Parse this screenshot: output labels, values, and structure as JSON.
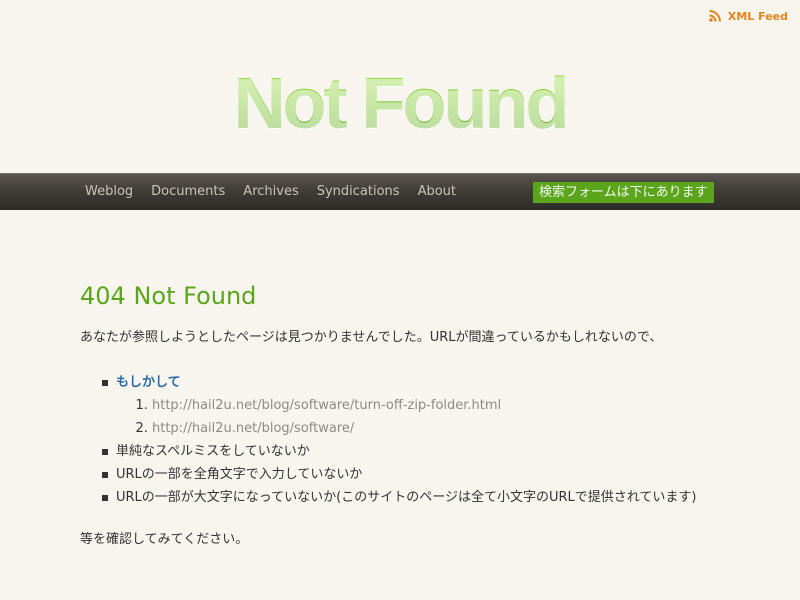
{
  "feed": {
    "label": "XML Feed",
    "icon": "rss-icon"
  },
  "logo": {
    "text": "Not Found"
  },
  "nav": {
    "items": [
      {
        "label": "Weblog"
      },
      {
        "label": "Documents"
      },
      {
        "label": "Archives"
      },
      {
        "label": "Syndications"
      },
      {
        "label": "About"
      }
    ],
    "search_note": "検索フォームは下にあります"
  },
  "main": {
    "heading": "404 Not Found",
    "intro": "あなたが参照しようとしたページは見つかりませんでした。URLが間違っているかもしれないので、",
    "checklist": [
      {
        "label": "もしかして"
      },
      {
        "label": "単純なスペルミスをしていないか"
      },
      {
        "label": "URLの一部を全角文字で入力していないか"
      },
      {
        "label": "URLの一部が大文字になっていないか(このサイトのページは全て小文字のURLで提供されています)"
      }
    ],
    "suggestions": [
      {
        "url": "http://hail2u.net/blog/software/turn-off-zip-folder.html"
      },
      {
        "url": "http://hail2u.net/blog/software/"
      }
    ],
    "closing": "等を確認してみてください。"
  },
  "colors": {
    "background": "#f8f5ef",
    "accent_green": "#5aa51c",
    "feed_orange": "#e2851c",
    "link_blue": "#2a6aa8",
    "navbar_dark": "#3f3b35"
  }
}
